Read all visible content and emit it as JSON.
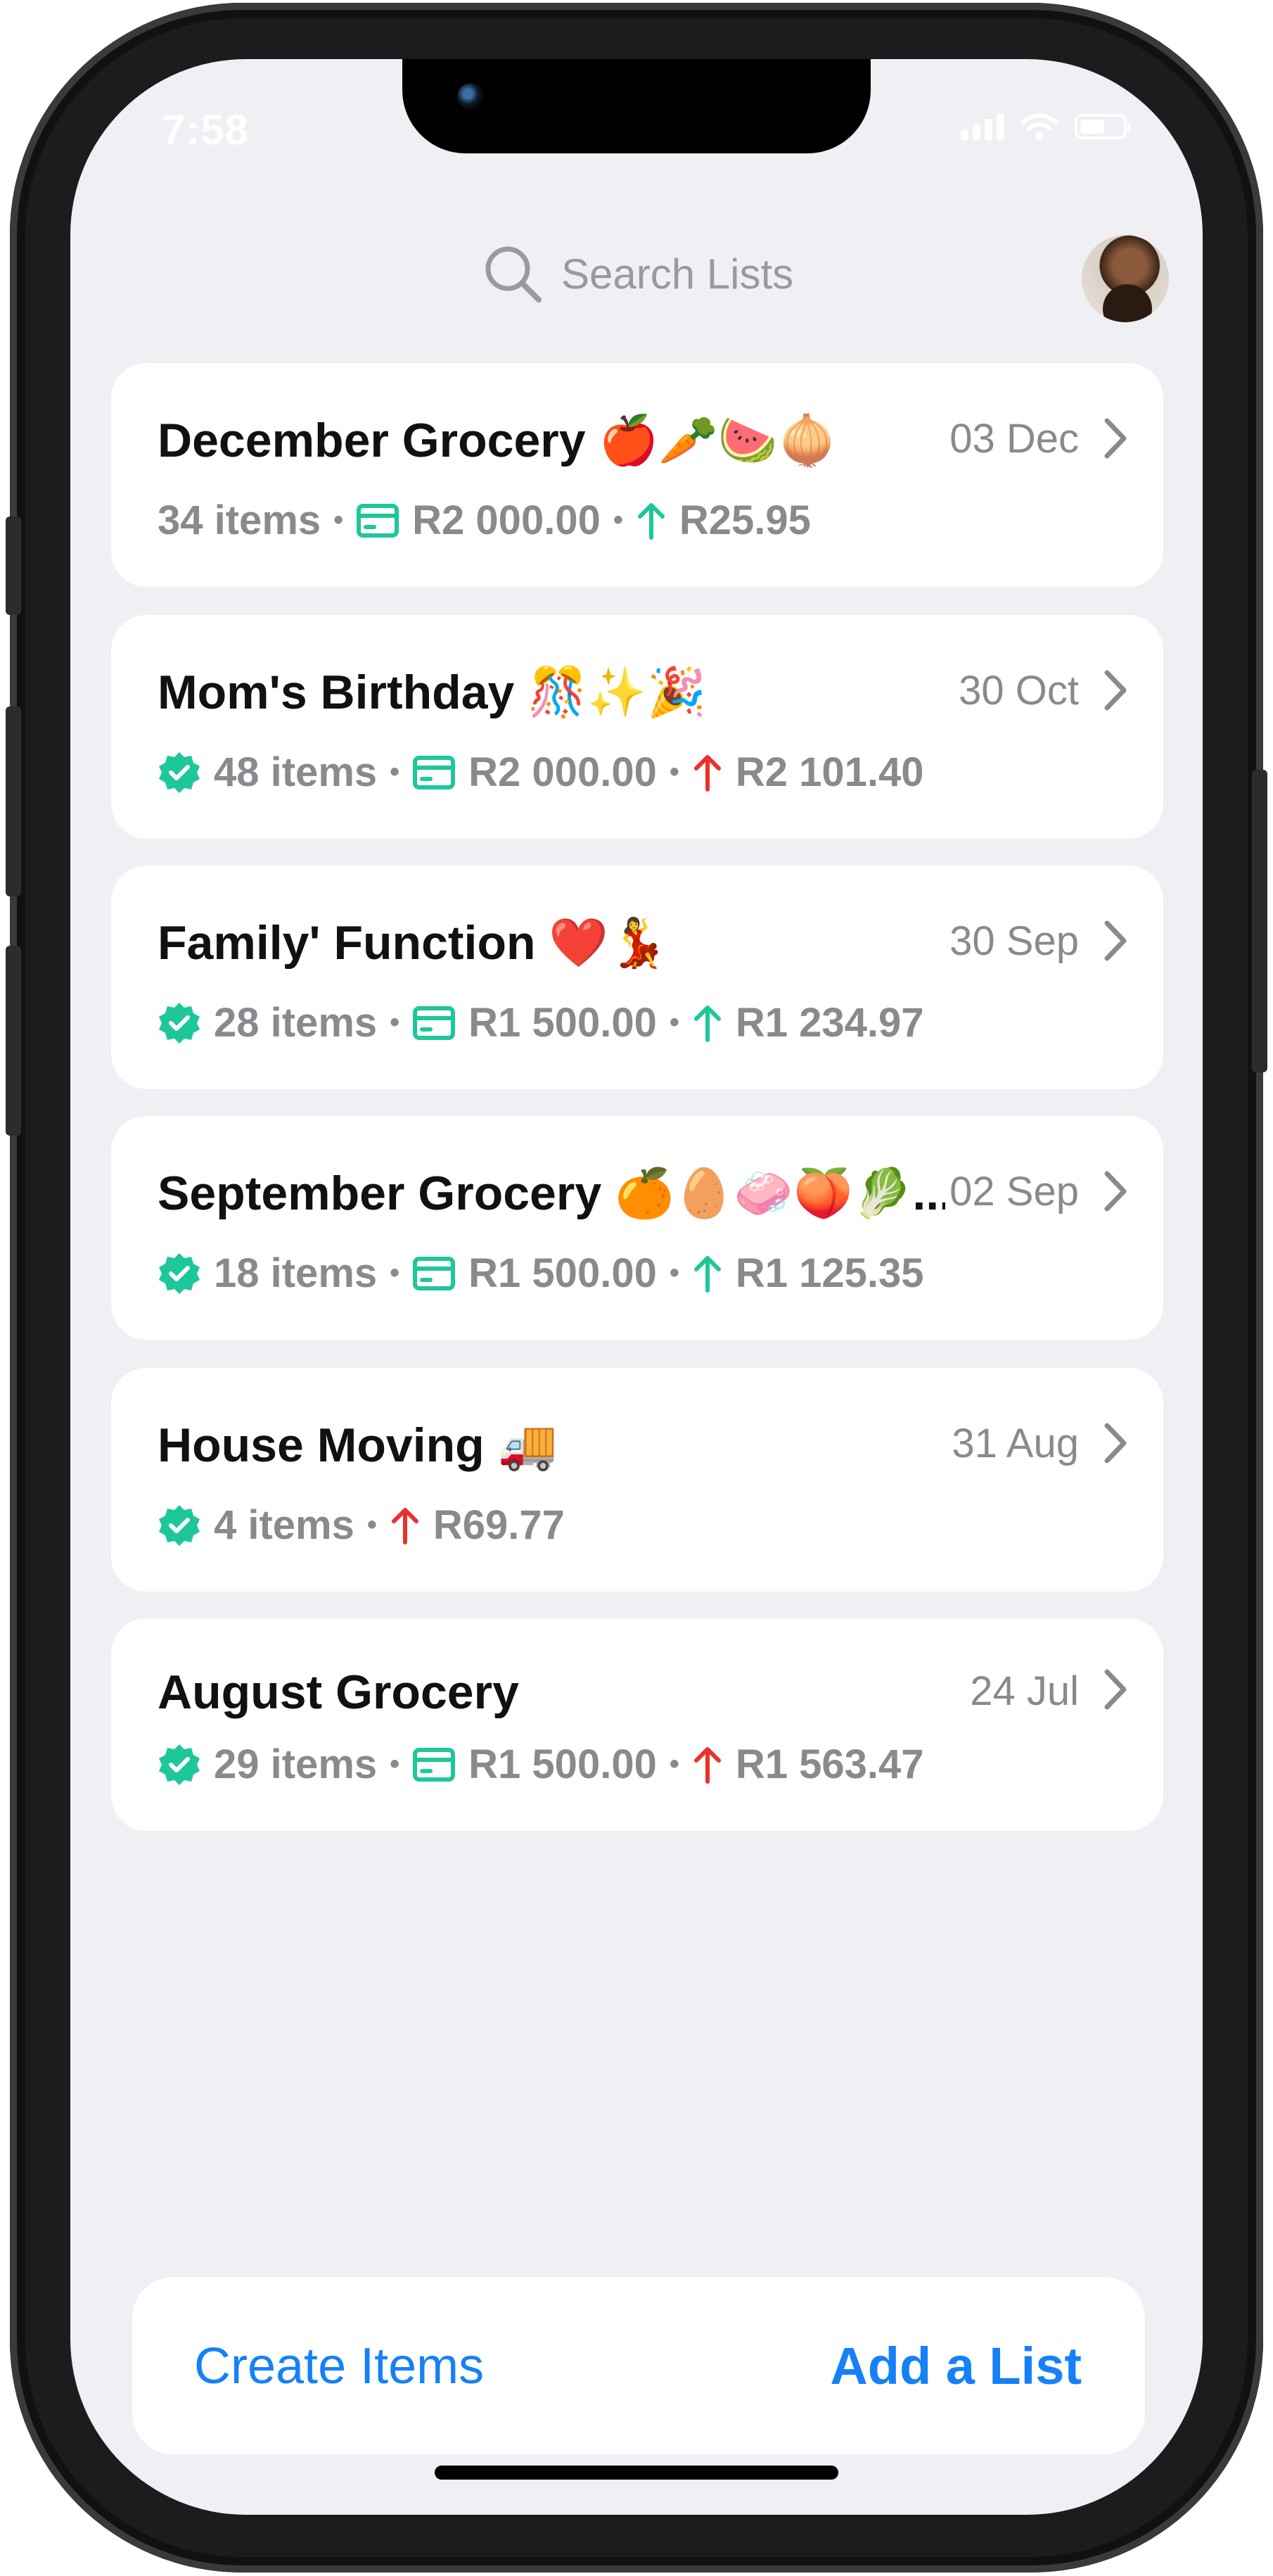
{
  "status_bar": {
    "time": "7:58"
  },
  "search": {
    "placeholder": "Search Lists"
  },
  "lists": [
    {
      "title": "December Grocery 🍎🥕🍉🧅",
      "date": "03 Dec",
      "verified": false,
      "items": "34 items",
      "budget": "R2 000.00",
      "spent": "R25.95",
      "trend": "up-green"
    },
    {
      "title": "Mom's Birthday 🎊✨🎉",
      "date": "30 Oct",
      "verified": true,
      "items": "48 items",
      "budget": "R2 000.00",
      "spent": "R2 101.40",
      "trend": "up-red"
    },
    {
      "title": "Family' Function ❤️💃",
      "date": "30 Sep",
      "verified": true,
      "items": "28 items",
      "budget": "R1 500.00",
      "spent": "R1 234.97",
      "trend": "up-green"
    },
    {
      "title": "September Grocery 🍊🥚🧼🍑🥬...",
      "date": "02 Sep",
      "verified": true,
      "items": "18 items",
      "budget": "R1 500.00",
      "spent": "R1 125.35",
      "trend": "up-green"
    },
    {
      "title": "House Moving 🚚",
      "date": "31 Aug",
      "verified": true,
      "items": "4 items",
      "budget": "",
      "spent": "R69.77",
      "trend": "up-red"
    },
    {
      "title": "August Grocery",
      "date": "24 Jul",
      "verified": true,
      "items": "29 items",
      "budget": "R1 500.00",
      "spent": "R1 563.47",
      "trend": "up-red"
    }
  ],
  "bottom_bar": {
    "create_label": "Create Items",
    "add_label": "Add a List"
  },
  "colors": {
    "accent": "#1680f7",
    "green": "#1ec79a",
    "red": "#e8332b",
    "background": "#efeff4"
  },
  "icons": {
    "search": "search-icon",
    "card": "card-icon",
    "verified": "verified-badge-icon",
    "arrow": "arrow-up-icon",
    "chevron": "chevron-right-icon"
  }
}
